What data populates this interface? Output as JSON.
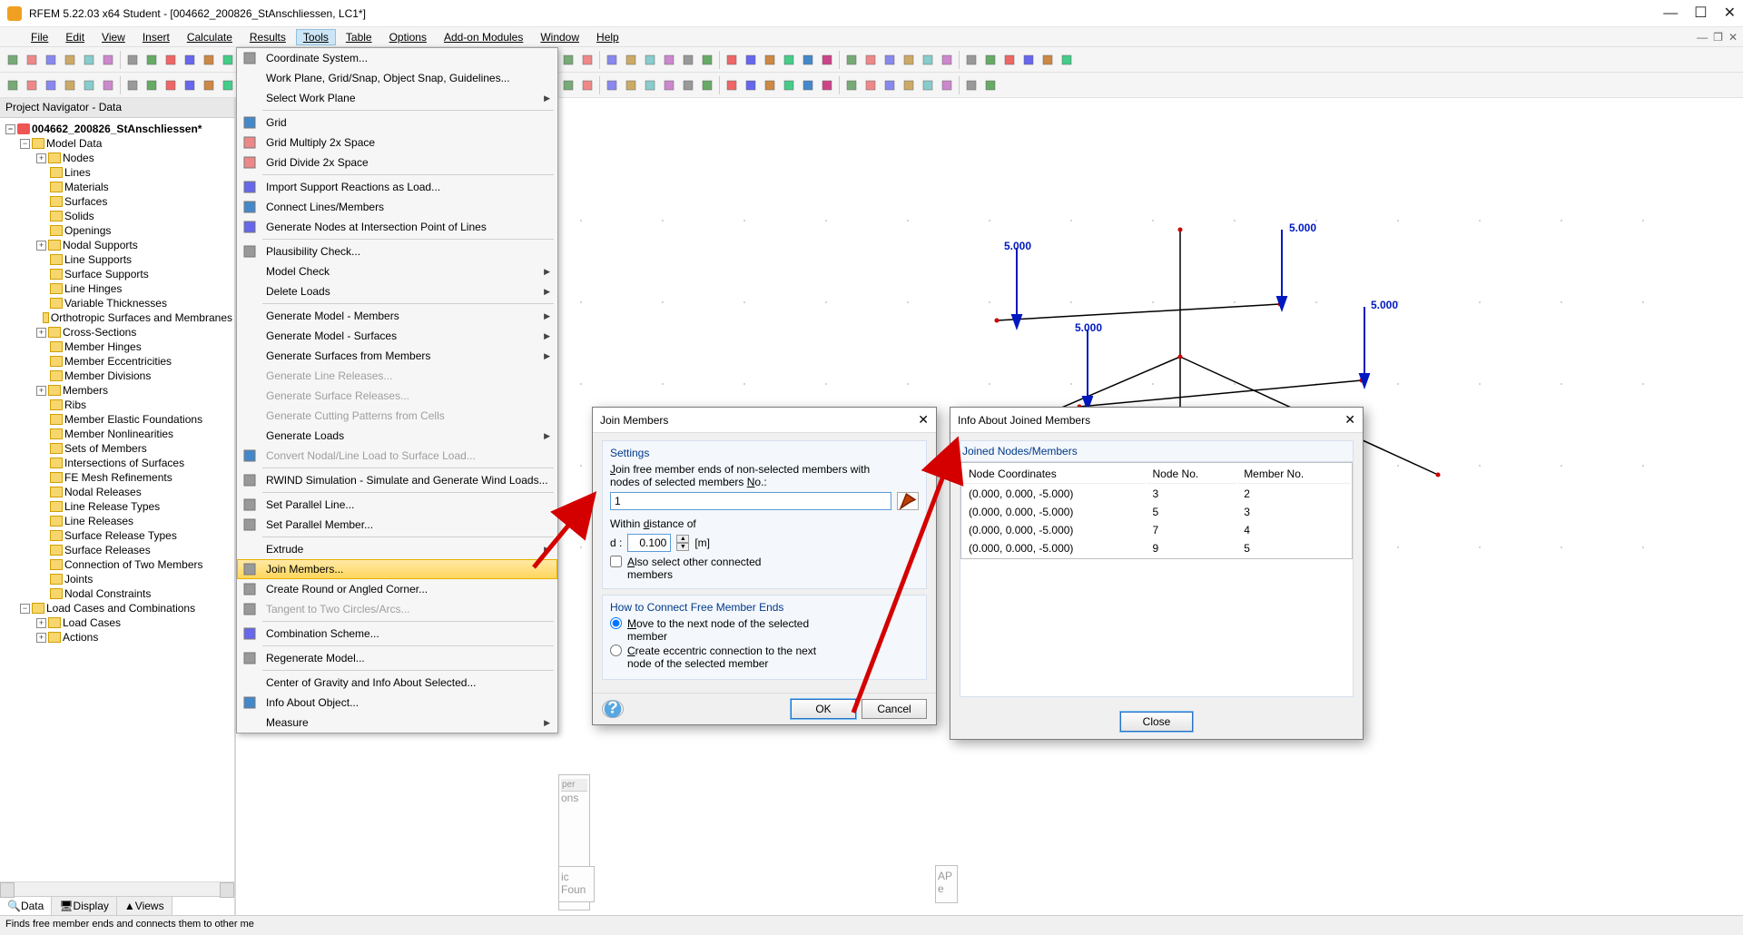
{
  "title": "RFEM 5.22.03 x64 Student - [004662_200826_StAnschliessen, LC1*]",
  "menu": {
    "file": "File",
    "edit": "Edit",
    "view": "View",
    "insert": "Insert",
    "calculate": "Calculate",
    "results": "Results",
    "tools": "Tools",
    "table": "Table",
    "options": "Options",
    "addons": "Add-on Modules",
    "window": "Window",
    "help": "Help"
  },
  "navigator": {
    "title": "Project Navigator - Data",
    "root": "004662_200826_StAnschliessen*",
    "model_data": "Model Data",
    "items": [
      "Nodes",
      "Lines",
      "Materials",
      "Surfaces",
      "Solids",
      "Openings",
      "Nodal Supports",
      "Line Supports",
      "Surface Supports",
      "Line Hinges",
      "Variable Thicknesses",
      "Orthotropic Surfaces and Membranes",
      "Cross-Sections",
      "Member Hinges",
      "Member Eccentricities",
      "Member Divisions",
      "Members",
      "Ribs",
      "Member Elastic Foundations",
      "Member Nonlinearities",
      "Sets of Members",
      "Intersections of Surfaces",
      "FE Mesh Refinements",
      "Nodal Releases",
      "Line Release Types",
      "Line Releases",
      "Surface Release Types",
      "Surface Releases",
      "Connection of Two Members",
      "Joints",
      "Nodal Constraints"
    ],
    "load_group": "Load Cases and Combinations",
    "load_items": [
      "Load Cases",
      "Actions"
    ],
    "tabs": {
      "data": "Data",
      "display": "Display",
      "views": "Views"
    }
  },
  "dropdown": [
    {
      "t": "Coordinate System...",
      "icon": "cs"
    },
    {
      "t": "Work Plane, Grid/Snap, Object Snap, Guidelines..."
    },
    {
      "t": "Select Work Plane",
      "sub": true
    },
    {
      "sep": true
    },
    {
      "t": "Grid",
      "icon": "grid"
    },
    {
      "t": "Grid Multiply 2x Space",
      "icon": "gridm"
    },
    {
      "t": "Grid Divide 2x Space",
      "icon": "gridd"
    },
    {
      "sep": true
    },
    {
      "t": "Import Support Reactions as Load...",
      "icon": "imp"
    },
    {
      "t": "Connect Lines/Members",
      "icon": "conn"
    },
    {
      "t": "Generate Nodes at Intersection Point of Lines",
      "icon": "gen"
    },
    {
      "sep": true
    },
    {
      "t": "Plausibility Check...",
      "icon": "pc"
    },
    {
      "t": "Model Check",
      "sub": true
    },
    {
      "t": "Delete Loads",
      "sub": true
    },
    {
      "sep": true
    },
    {
      "t": "Generate Model - Members",
      "sub": true
    },
    {
      "t": "Generate Model - Surfaces",
      "sub": true
    },
    {
      "t": "Generate Surfaces from Members",
      "sub": true
    },
    {
      "t": "Generate Line Releases...",
      "dis": true
    },
    {
      "t": "Generate Surface Releases...",
      "dis": true
    },
    {
      "t": "Generate Cutting Patterns from Cells",
      "dis": true
    },
    {
      "t": "Generate Loads",
      "sub": true
    },
    {
      "t": "Convert Nodal/Line Load to Surface Load...",
      "dis": true,
      "icon": "conv"
    },
    {
      "sep": true
    },
    {
      "t": "RWIND Simulation - Simulate and Generate Wind Loads...",
      "icon": "rw"
    },
    {
      "sep": true
    },
    {
      "t": "Set Parallel Line...",
      "icon": "pl"
    },
    {
      "t": "Set Parallel Member...",
      "icon": "pm"
    },
    {
      "sep": true
    },
    {
      "t": "Extrude",
      "sub": true
    },
    {
      "t": "Join Members...",
      "icon": "jm",
      "hl": true
    },
    {
      "t": "Create Round or Angled Corner...",
      "icon": "cr"
    },
    {
      "t": "Tangent to Two Circles/Arcs...",
      "dis": true,
      "icon": "tg"
    },
    {
      "sep": true
    },
    {
      "t": "Combination Scheme...",
      "icon": "cs2"
    },
    {
      "sep": true
    },
    {
      "t": "Regenerate Model...",
      "icon": "rg"
    },
    {
      "sep": true
    },
    {
      "t": "Center of Gravity and Info About Selected..."
    },
    {
      "t": "Info About Object...",
      "icon": "info"
    },
    {
      "t": "Measure",
      "sub": true
    }
  ],
  "join_dialog": {
    "title": "Join Members",
    "settings": "Settings",
    "instr1": "Join free member ends of non-selected members with",
    "instr2": "nodes of selected members No.:",
    "member_no": "1",
    "within": "Within distance of",
    "d_label": "d :",
    "d_value": "0.100",
    "d_unit": "[m]",
    "also_label1": "Also select other connected",
    "also_label2": "members",
    "how_title": "How to Connect Free Member Ends",
    "opt1a": "Move to the next node of the selected",
    "opt1b": "member",
    "opt2a": "Create eccentric connection to the next",
    "opt2b": "node of the selected member",
    "ok": "OK",
    "cancel": "Cancel"
  },
  "info_dialog": {
    "title": "Info About Joined Members",
    "section": "Joined Nodes/Members",
    "cols": {
      "coord": "Node Coordinates",
      "node": "Node No.",
      "member": "Member No."
    },
    "rows": [
      {
        "c": "(0.000, 0.000, -5.000)",
        "n": "3",
        "m": "2"
      },
      {
        "c": "(0.000, 0.000, -5.000)",
        "n": "5",
        "m": "3"
      },
      {
        "c": "(0.000, 0.000, -5.000)",
        "n": "7",
        "m": "4"
      },
      {
        "c": "(0.000, 0.000, -5.000)",
        "n": "9",
        "m": "5"
      }
    ],
    "close": "Close"
  },
  "statusbar": "Finds free member ends and connects them to other me",
  "canvas_labels": {
    "l": "5.000"
  },
  "frag_labels": {
    "per": "per",
    "ons": "ons",
    "found": "ic Foun",
    "ap": "AP",
    "e": "e"
  }
}
